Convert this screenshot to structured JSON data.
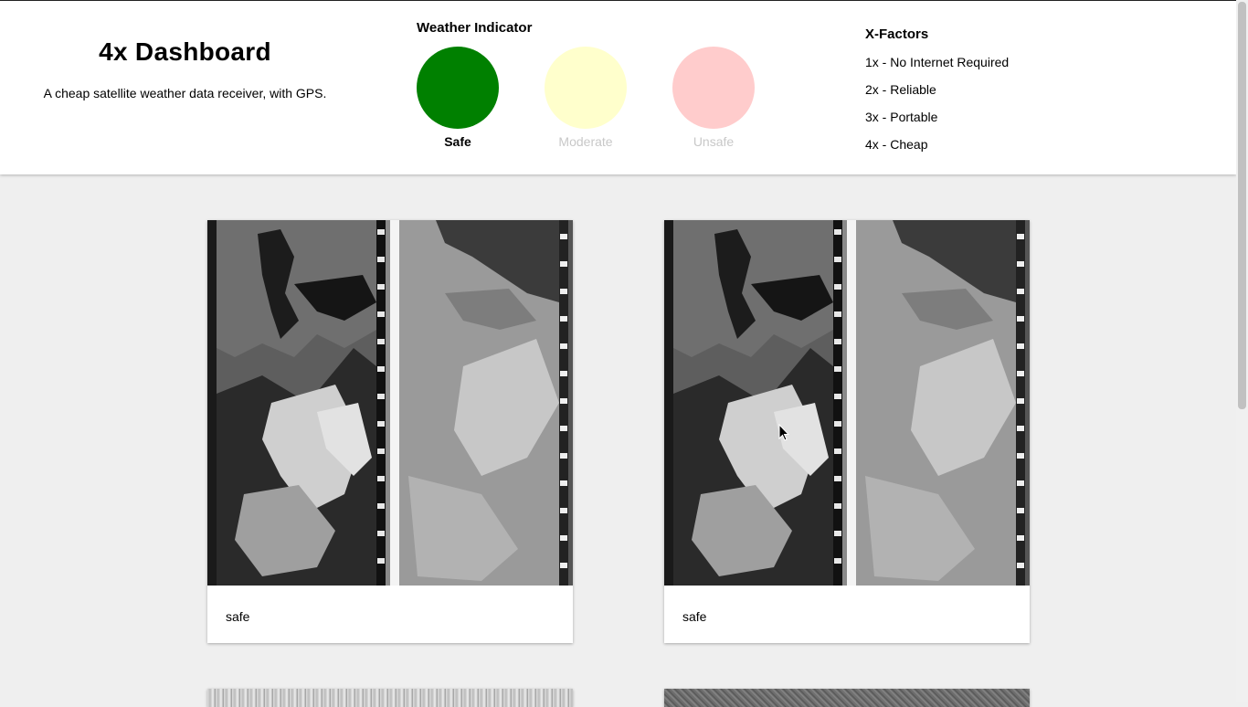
{
  "header": {
    "title": "4x Dashboard",
    "subtitle": "A cheap satellite weather data receiver, with GPS."
  },
  "weather_indicator": {
    "heading": "Weather Indicator",
    "levels": [
      {
        "label": "Safe",
        "color": "#008000",
        "active": true
      },
      {
        "label": "Moderate",
        "color": "#ffffcc",
        "active": false
      },
      {
        "label": "Unsafe",
        "color": "#ffcccc",
        "active": false
      }
    ]
  },
  "x_factors": {
    "heading": "X-Factors",
    "items": [
      "1x - No Internet Required",
      "2x - Reliable",
      "3x - Portable",
      "4x - Cheap"
    ]
  },
  "cards": [
    {
      "label": "safe",
      "image": "satellite-apt-image"
    },
    {
      "label": "safe",
      "image": "satellite-apt-image"
    }
  ],
  "colors": {
    "background": "#efefef",
    "active_label": "#000000",
    "inactive_label": "#c8c8c8"
  }
}
